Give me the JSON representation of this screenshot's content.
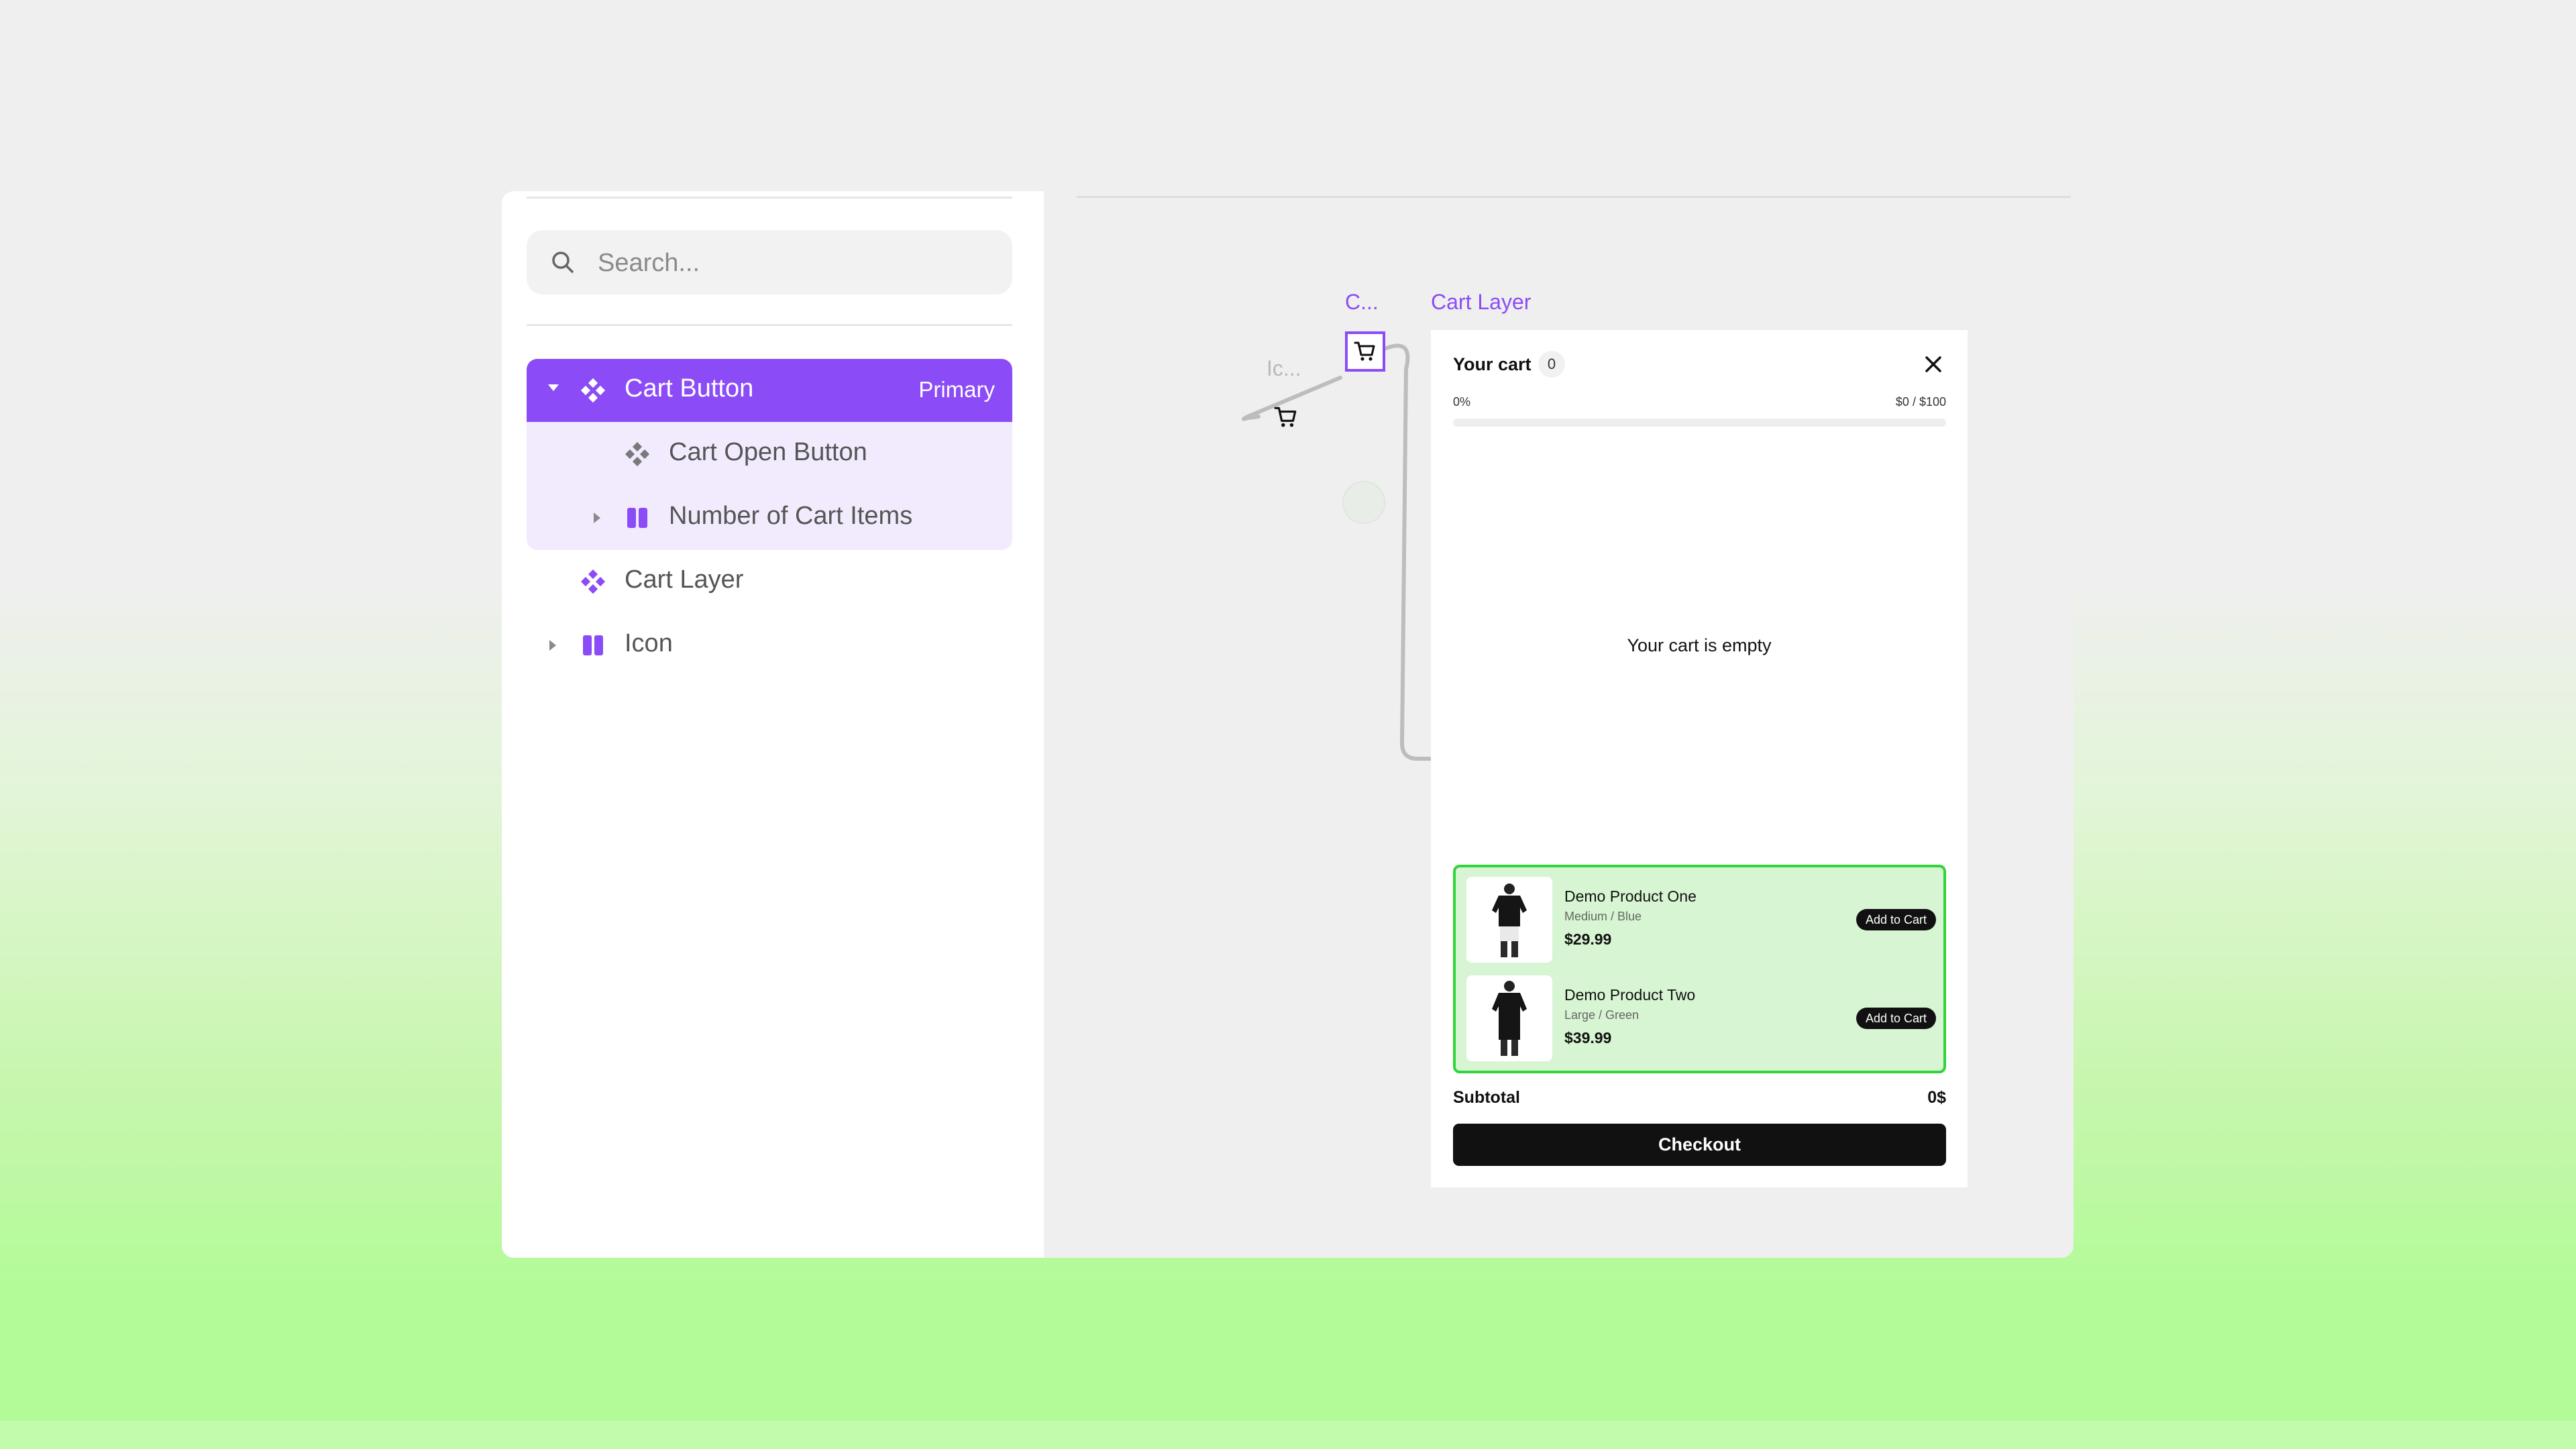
{
  "sidebar": {
    "search": {
      "placeholder": "Search..."
    },
    "tree": [
      {
        "label": "Cart Button",
        "badge": "Primary",
        "icon": "component-icon",
        "expanded": true,
        "selected": true
      },
      {
        "label": "Cart Open Button",
        "icon": "component-icon"
      },
      {
        "label": "Number of Cart Items",
        "icon": "frame-icon",
        "collapsed": true
      },
      {
        "label": "Cart Layer",
        "icon": "component-icon"
      },
      {
        "label": "Icon",
        "icon": "frame-icon",
        "collapsed": true
      }
    ]
  },
  "canvas": {
    "cart_button_label": "C...",
    "cart_layer_label": "Cart Layer",
    "icon_label": "Ic..."
  },
  "cart": {
    "title": "Your cart",
    "count": "0",
    "progress_percent_text": "0%",
    "progress_fraction": 0,
    "amount_text": "$0 / $100",
    "empty_message": "Your cart is empty",
    "products": [
      {
        "name": "Demo Product One",
        "variant": "Medium / Blue",
        "price": "$29.99",
        "button": "Add to Cart"
      },
      {
        "name": "Demo Product Two",
        "variant": "Large / Green",
        "price": "$39.99",
        "button": "Add to Cart"
      }
    ],
    "subtotal_label": "Subtotal",
    "subtotal_value": "0$",
    "checkout_label": "Checkout"
  },
  "colors": {
    "accent": "#8b4cf7",
    "accent_light": "#f2ebfe",
    "upsell_bg": "#d7f5d2",
    "upsell_border": "#31d43a",
    "dark": "#111111"
  }
}
